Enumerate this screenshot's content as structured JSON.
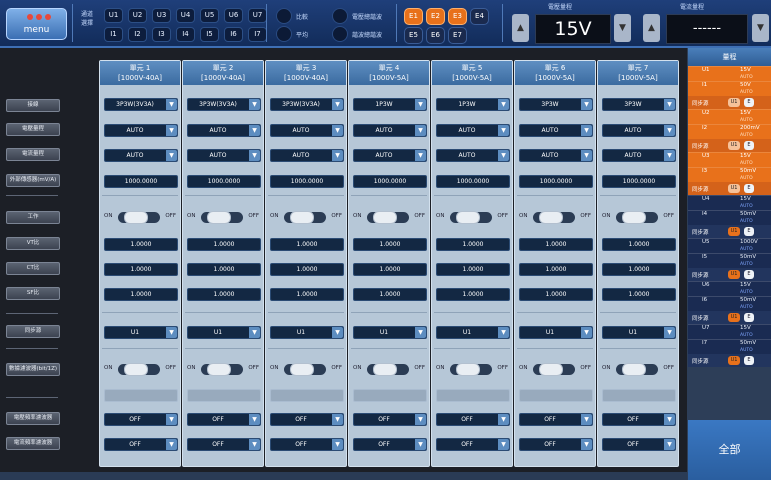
{
  "menu": {
    "label": "menu"
  },
  "legend_label": "通道\n選擇",
  "voltage_channels": [
    "U1",
    "U2",
    "U3",
    "U4",
    "U5",
    "U6",
    "U7"
  ],
  "current_channels": [
    "I1",
    "I2",
    "I3",
    "I4",
    "I5",
    "I6",
    "I7"
  ],
  "radio": {
    "r1": "比較",
    "r2": "平均",
    "r3": "電壓總諧波",
    "r4": "諧波總諧波"
  },
  "e_buttons": [
    {
      "label": "E1",
      "active": true
    },
    {
      "label": "E2",
      "active": true
    },
    {
      "label": "E3",
      "active": true
    },
    {
      "label": "E4",
      "active": false
    },
    {
      "label": "E5",
      "active": false
    },
    {
      "label": "E6",
      "active": false
    },
    {
      "label": "E7",
      "active": false
    }
  ],
  "voltage_range": {
    "label": "電壓量程",
    "value": "15V",
    "dec": "▲",
    "inc": "▼"
  },
  "current_range": {
    "label": "電流量程",
    "value": "------",
    "dec": "▲",
    "inc": "▼"
  },
  "row_labels": [
    "接線",
    "電壓量程",
    "電流量程",
    "外部傳感器(mV/A)",
    "工作",
    "VT比",
    "CT比",
    "SF比",
    "同步源",
    "數據濾波器(bit/1Z)",
    "電壓頻率濾波器",
    "電流頻率濾波器"
  ],
  "columns": [
    {
      "title": "單元 1",
      "rating": "[1000V-40A]",
      "wiring": "3P3W(3V3A)",
      "vrange": "AUTO",
      "irange": "AUTO",
      "sensor": "1000.0000",
      "vt": "1.0000",
      "ct": "1.0000",
      "sf": "1.0000",
      "sync": "U1",
      "vfilter": "OFF",
      "ifilter": "OFF"
    },
    {
      "title": "單元 2",
      "rating": "[1000V-40A]",
      "wiring": "3P3W(3V3A)",
      "vrange": "AUTO",
      "irange": "AUTO",
      "sensor": "1000.0000",
      "vt": "1.0000",
      "ct": "1.0000",
      "sf": "1.0000",
      "sync": "U1",
      "vfilter": "OFF",
      "ifilter": "OFF"
    },
    {
      "title": "單元 3",
      "rating": "[1000V-40A]",
      "wiring": "3P3W(3V3A)",
      "vrange": "AUTO",
      "irange": "AUTO",
      "sensor": "1000.0000",
      "vt": "1.0000",
      "ct": "1.0000",
      "sf": "1.0000",
      "sync": "U1",
      "vfilter": "OFF",
      "ifilter": "OFF"
    },
    {
      "title": "單元 4",
      "rating": "[1000V-5A]",
      "wiring": "1P3W",
      "vrange": "AUTO",
      "irange": "AUTO",
      "sensor": "1000.0000",
      "vt": "1.0000",
      "ct": "1.0000",
      "sf": "1.0000",
      "sync": "U1",
      "vfilter": "OFF",
      "ifilter": "OFF"
    },
    {
      "title": "單元 5",
      "rating": "[1000V-5A]",
      "wiring": "1P3W",
      "vrange": "AUTO",
      "irange": "AUTO",
      "sensor": "1000.0000",
      "vt": "1.0000",
      "ct": "1.0000",
      "sf": "1.0000",
      "sync": "U1",
      "vfilter": "OFF",
      "ifilter": "OFF"
    },
    {
      "title": "單元 6",
      "rating": "[1000V-5A]",
      "wiring": "3P3W",
      "vrange": "AUTO",
      "irange": "AUTO",
      "sensor": "1000.0000",
      "vt": "1.0000",
      "ct": "1.0000",
      "sf": "1.0000",
      "sync": "U1",
      "vfilter": "OFF",
      "ifilter": "OFF"
    },
    {
      "title": "單元 7",
      "rating": "[1000V-5A]",
      "wiring": "3P3W",
      "vrange": "AUTO",
      "irange": "AUTO",
      "sensor": "1000.0000",
      "vt": "1.0000",
      "ct": "1.0000",
      "sf": "1.0000",
      "sync": "U1",
      "vfilter": "OFF",
      "ifilter": "OFF"
    }
  ],
  "toggle": {
    "on": "ON",
    "off": "OFF"
  },
  "right_panel": {
    "title": "量程",
    "ctrl_label": "同步源",
    "ctrl_btn1": "U1",
    "ctrl_btn2": "E",
    "groups": [
      {
        "active": true,
        "rows": [
          {
            "ch": "U1",
            "val": "15V",
            "sub": "AUTO"
          },
          {
            "ch": "I1",
            "val": "50V",
            "sub": "AUTO"
          }
        ]
      },
      {
        "active": true,
        "rows": [
          {
            "ch": "U2",
            "val": "15V",
            "sub": "AUTO"
          },
          {
            "ch": "I2",
            "val": "200mV",
            "sub": "AUTO"
          }
        ]
      },
      {
        "active": true,
        "rows": [
          {
            "ch": "U3",
            "val": "15V",
            "sub": "AUTO"
          },
          {
            "ch": "I3",
            "val": "50mV",
            "sub": "AUTO"
          }
        ]
      },
      {
        "active": false,
        "rows": [
          {
            "ch": "U4",
            "val": "15V",
            "sub": "AUTO"
          },
          {
            "ch": "I4",
            "val": "50mV",
            "sub": "AUTO"
          }
        ]
      },
      {
        "active": false,
        "rows": [
          {
            "ch": "U5",
            "val": "1000V",
            "sub": "AUTO"
          },
          {
            "ch": "I5",
            "val": "50mV",
            "sub": "AUTO"
          }
        ]
      },
      {
        "active": false,
        "rows": [
          {
            "ch": "U6",
            "val": "15V",
            "sub": "AUTO"
          },
          {
            "ch": "I6",
            "val": "50mV",
            "sub": "AUTO"
          }
        ]
      },
      {
        "active": false,
        "rows": [
          {
            "ch": "U7",
            "val": "15V",
            "sub": "AUTO"
          },
          {
            "ch": "I7",
            "val": "50mV",
            "sub": "AUTO"
          }
        ]
      }
    ],
    "all_label": "全部"
  },
  "colors": {
    "accent": "#e8711b",
    "panel": "#b6c7d7",
    "header": "#3b6ba0"
  }
}
